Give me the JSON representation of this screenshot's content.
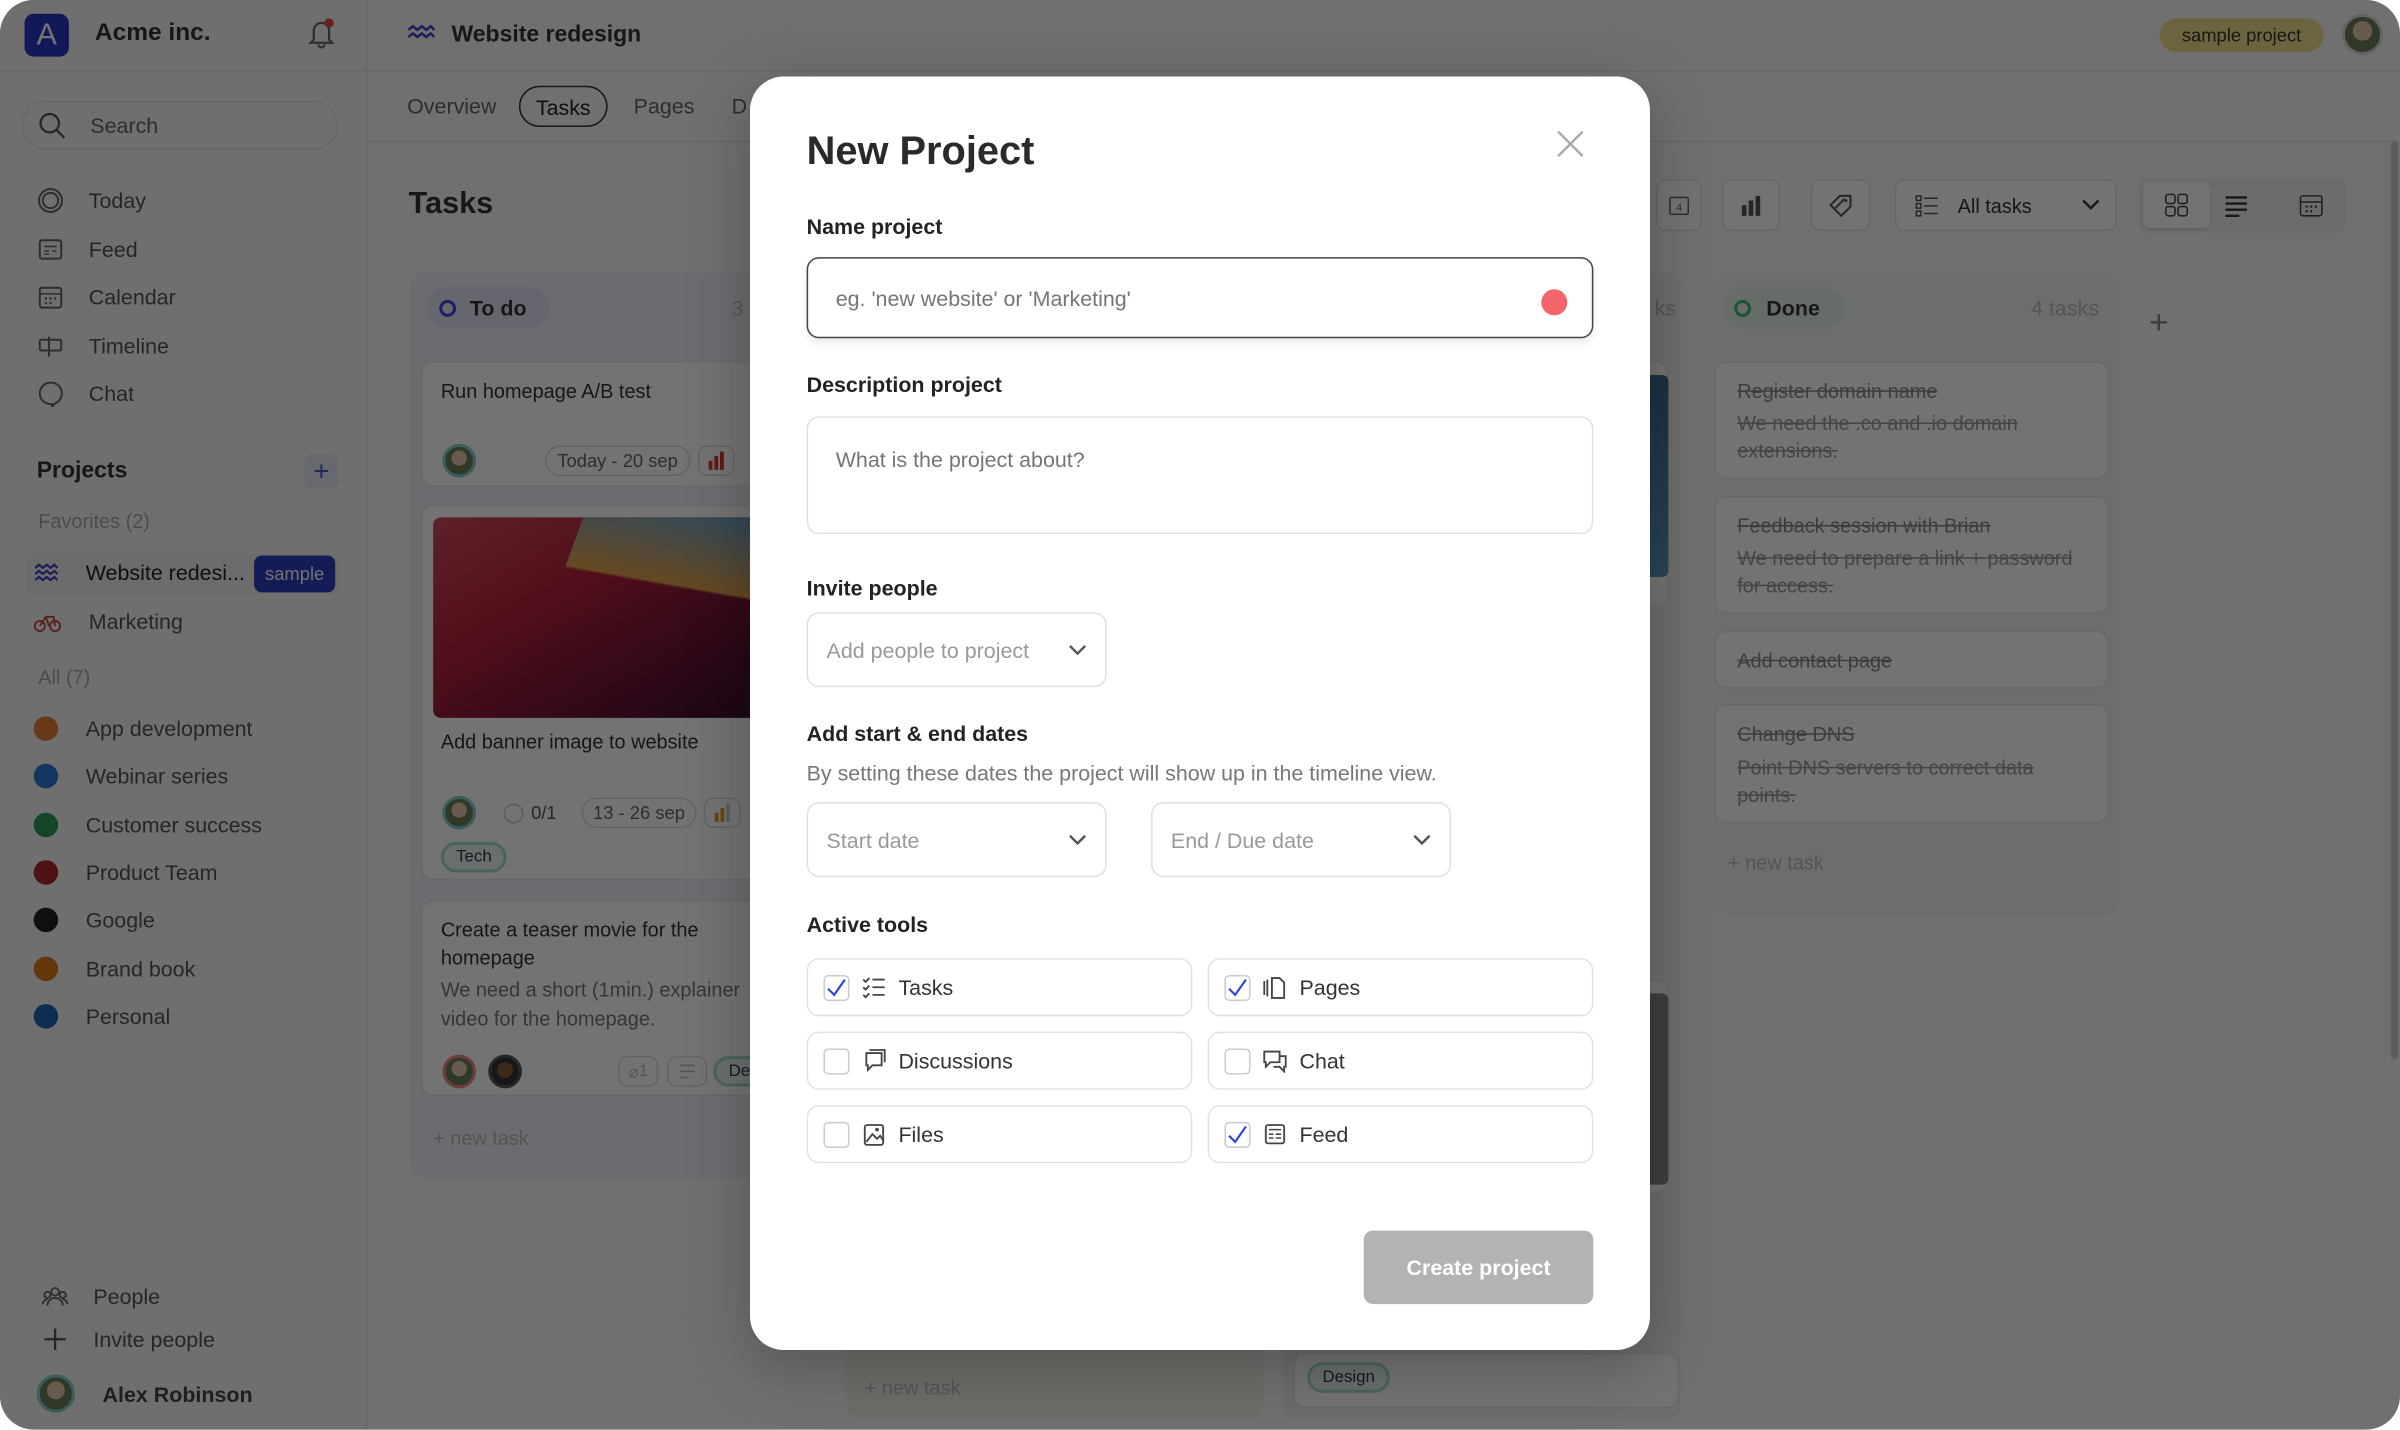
{
  "workspace": {
    "logo_letter": "A",
    "name": "Acme inc."
  },
  "search": {
    "placeholder": "Search"
  },
  "nav": [
    {
      "label": "Today",
      "icon": "target-icon"
    },
    {
      "label": "Feed",
      "icon": "feed-icon"
    },
    {
      "label": "Calendar",
      "icon": "calendar-icon"
    },
    {
      "label": "Timeline",
      "icon": "timeline-icon"
    },
    {
      "label": "Chat",
      "icon": "chat-icon"
    }
  ],
  "projects": {
    "heading": "Projects",
    "favorites_label": "Favorites (2)",
    "all_label": "All (7)",
    "favorites": [
      {
        "label": "Website redesi...",
        "badge": "sample",
        "icon": "wave-icon"
      },
      {
        "label": "Marketing",
        "icon": "bicycle-icon"
      }
    ],
    "all": [
      {
        "label": "App development",
        "color": "#e8823a"
      },
      {
        "label": "Webinar series",
        "color": "#2a7ad8"
      },
      {
        "label": "Customer success",
        "color": "#2c9a55"
      },
      {
        "label": "Product Team",
        "color": "#b0282a"
      },
      {
        "label": "Google",
        "color": "#222222"
      },
      {
        "label": "Brand book",
        "color": "#e07a1a"
      },
      {
        "label": "Personal",
        "color": "#1f63b8"
      }
    ]
  },
  "sidebar_bottom": {
    "people": "People",
    "invite": "Invite people",
    "user": "Alex Robinson"
  },
  "header": {
    "project_title": "Website redesign",
    "badge": "sample project",
    "badge_color": "#f1df8c"
  },
  "tabs": [
    {
      "label": "Overview"
    },
    {
      "label": "Tasks",
      "active": true
    },
    {
      "label": "Pages"
    },
    {
      "label": "D"
    }
  ],
  "page_title": "Tasks",
  "toolbar": {
    "filter_label": "All tasks",
    "calendar_day": "4"
  },
  "columns": {
    "todo": {
      "title": "To do",
      "count": "3",
      "new_task": "+ new task",
      "cards": [
        {
          "title": "Run homepage A/B test",
          "date": "Today - 20 sep",
          "priority_color": "#d43a2a"
        },
        {
          "title": "Add banner image to website",
          "subtasks": "0/1",
          "date": "13 - 26 sep",
          "tag": "Tech",
          "priority_color": "#e0a020"
        },
        {
          "title": "Create a teaser movie for the homepage",
          "description": "We need a short (1min.) explainer video for the homepage.",
          "attachments": "1",
          "tag": "De"
        }
      ]
    },
    "middle": {
      "new_task": "+ new task"
    },
    "third": {
      "tag": "Design",
      "count_fragment": "ks"
    },
    "done": {
      "title": "Done",
      "count": "4 tasks",
      "new_task": "+ new task",
      "cards": [
        {
          "title": "Register domain name",
          "description": "We need the .co and .io domain extensions."
        },
        {
          "title": "Feedback session with Brian",
          "description": "We need to prepare a link + password for access."
        },
        {
          "title": "Add contact page"
        },
        {
          "title": "Change DNS",
          "description": "Point DNS servers to correct data points."
        }
      ]
    }
  },
  "modal": {
    "title": "New Project",
    "name_label": "Name project",
    "name_placeholder": "eg. 'new website' or 'Marketing'",
    "desc_label": "Description project",
    "desc_placeholder": "What is the project about?",
    "invite_label": "Invite people",
    "invite_placeholder": "Add people to project",
    "dates_label": "Add start & end dates",
    "dates_help": "By setting these dates the project will show up in the timeline view.",
    "start_placeholder": "Start date",
    "end_placeholder": "End / Due date",
    "tools_label": "Active tools",
    "tools": [
      {
        "label": "Tasks",
        "checked": true
      },
      {
        "label": "Pages",
        "checked": true
      },
      {
        "label": "Discussions",
        "checked": false
      },
      {
        "label": "Chat",
        "checked": false
      },
      {
        "label": "Files",
        "checked": false
      },
      {
        "label": "Feed",
        "checked": true
      }
    ],
    "submit": "Create project",
    "accent": "#2f3fe0",
    "required_dot": "#f2656b"
  }
}
